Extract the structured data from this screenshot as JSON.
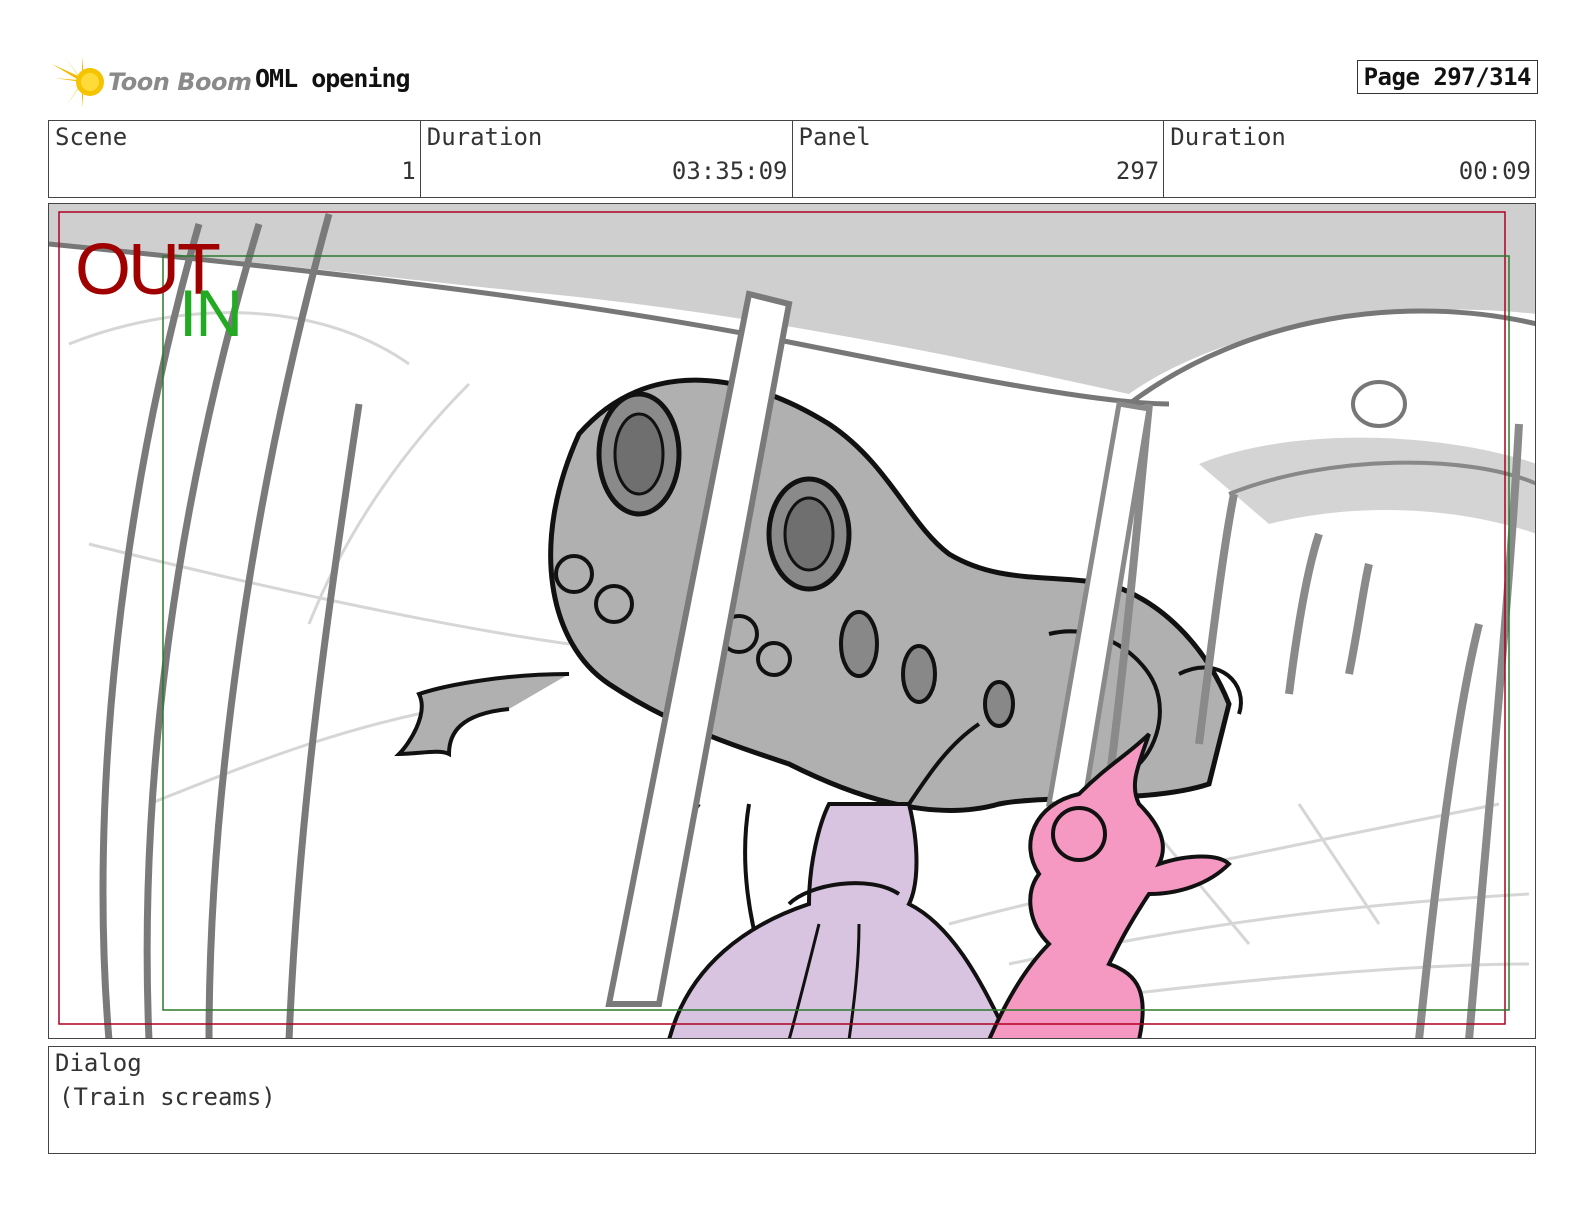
{
  "header": {
    "brand": "Toon Boom",
    "project_title": "OML opening",
    "page": "Page 297/314"
  },
  "info": {
    "scene_label": "Scene",
    "scene_value": "1",
    "scene_duration_label": "Duration",
    "scene_duration_value": "03:35:09",
    "panel_label": "Panel",
    "panel_value": "297",
    "panel_duration_label": "Duration",
    "panel_duration_value": "00:09"
  },
  "frame": {
    "out_label": "OUT",
    "in_label": "IN",
    "out_color": "#a00000",
    "in_color": "#22aa22"
  },
  "dialog": {
    "label": "Dialog",
    "text": "(Train screams)"
  }
}
